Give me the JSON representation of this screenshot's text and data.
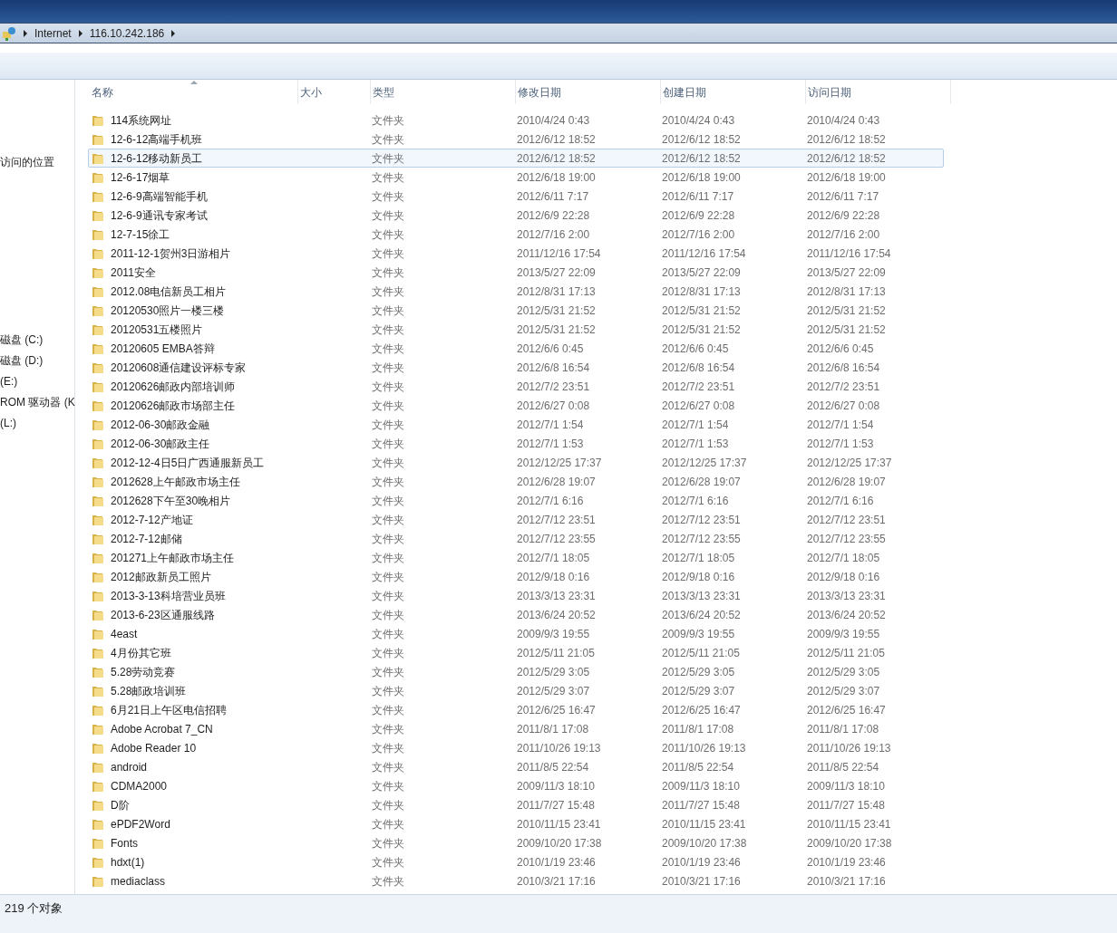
{
  "address_bar": {
    "segments": [
      "Internet",
      "116.10.242.186"
    ]
  },
  "sidebar": {
    "items": [
      {
        "label": "访问的位置",
        "kind": "link"
      },
      {
        "label": "磁盘 (C:)",
        "kind": "drive"
      },
      {
        "label": "磁盘 (D:)",
        "kind": "drive"
      },
      {
        "label": "(E:)",
        "kind": "drive"
      },
      {
        "label": "ROM 驱动器 (K",
        "kind": "drive"
      },
      {
        "label": "(L:)",
        "kind": "drive"
      }
    ]
  },
  "table": {
    "columns": [
      {
        "label": "名称",
        "sorted": true
      },
      {
        "label": "大小",
        "sorted": false
      },
      {
        "label": "类型",
        "sorted": false
      },
      {
        "label": "修改日期",
        "sorted": false
      },
      {
        "label": "创建日期",
        "sorted": false
      },
      {
        "label": "访问日期",
        "sorted": false
      }
    ],
    "rows": [
      {
        "name": "114系统网址",
        "type": "文件夹",
        "modified": "2010/4/24 0:43",
        "created": "2010/4/24 0:43",
        "accessed": "2010/4/24 0:43",
        "selected": false
      },
      {
        "name": "12-6-12高端手机班",
        "type": "文件夹",
        "modified": "2012/6/12 18:52",
        "created": "2012/6/12 18:52",
        "accessed": "2012/6/12 18:52",
        "selected": false
      },
      {
        "name": "12-6-12移动新员工",
        "type": "文件夹",
        "modified": "2012/6/12 18:52",
        "created": "2012/6/12 18:52",
        "accessed": "2012/6/12 18:52",
        "selected": true
      },
      {
        "name": "12-6-17烟草",
        "type": "文件夹",
        "modified": "2012/6/18 19:00",
        "created": "2012/6/18 19:00",
        "accessed": "2012/6/18 19:00",
        "selected": false
      },
      {
        "name": "12-6-9高端智能手机",
        "type": "文件夹",
        "modified": "2012/6/11 7:17",
        "created": "2012/6/11 7:17",
        "accessed": "2012/6/11 7:17",
        "selected": false
      },
      {
        "name": "12-6-9通讯专家考试",
        "type": "文件夹",
        "modified": "2012/6/9 22:28",
        "created": "2012/6/9 22:28",
        "accessed": "2012/6/9 22:28",
        "selected": false
      },
      {
        "name": "12-7-15徐工",
        "type": "文件夹",
        "modified": "2012/7/16 2:00",
        "created": "2012/7/16 2:00",
        "accessed": "2012/7/16 2:00",
        "selected": false
      },
      {
        "name": "2011-12-1贺州3日游相片",
        "type": "文件夹",
        "modified": "2011/12/16 17:54",
        "created": "2011/12/16 17:54",
        "accessed": "2011/12/16 17:54",
        "selected": false
      },
      {
        "name": "2011安全",
        "type": "文件夹",
        "modified": "2013/5/27 22:09",
        "created": "2013/5/27 22:09",
        "accessed": "2013/5/27 22:09",
        "selected": false
      },
      {
        "name": "2012.08电信新员工相片",
        "type": "文件夹",
        "modified": "2012/8/31 17:13",
        "created": "2012/8/31 17:13",
        "accessed": "2012/8/31 17:13",
        "selected": false
      },
      {
        "name": "20120530照片一楼三楼",
        "type": "文件夹",
        "modified": "2012/5/31 21:52",
        "created": "2012/5/31 21:52",
        "accessed": "2012/5/31 21:52",
        "selected": false
      },
      {
        "name": "20120531五楼照片",
        "type": "文件夹",
        "modified": "2012/5/31 21:52",
        "created": "2012/5/31 21:52",
        "accessed": "2012/5/31 21:52",
        "selected": false
      },
      {
        "name": "20120605 EMBA答辩",
        "type": "文件夹",
        "modified": "2012/6/6 0:45",
        "created": "2012/6/6 0:45",
        "accessed": "2012/6/6 0:45",
        "selected": false
      },
      {
        "name": "20120608通信建设评标专家",
        "type": "文件夹",
        "modified": "2012/6/8 16:54",
        "created": "2012/6/8 16:54",
        "accessed": "2012/6/8 16:54",
        "selected": false
      },
      {
        "name": "20120626邮政内部培训师",
        "type": "文件夹",
        "modified": "2012/7/2 23:51",
        "created": "2012/7/2 23:51",
        "accessed": "2012/7/2 23:51",
        "selected": false
      },
      {
        "name": "20120626邮政市场部主任",
        "type": "文件夹",
        "modified": "2012/6/27 0:08",
        "created": "2012/6/27 0:08",
        "accessed": "2012/6/27 0:08",
        "selected": false
      },
      {
        "name": "2012-06-30邮政金融",
        "type": "文件夹",
        "modified": "2012/7/1 1:54",
        "created": "2012/7/1 1:54",
        "accessed": "2012/7/1 1:54",
        "selected": false
      },
      {
        "name": "2012-06-30邮政主任",
        "type": "文件夹",
        "modified": "2012/7/1 1:53",
        "created": "2012/7/1 1:53",
        "accessed": "2012/7/1 1:53",
        "selected": false
      },
      {
        "name": "2012-12-4日5日广西通服新员工",
        "type": "文件夹",
        "modified": "2012/12/25 17:37",
        "created": "2012/12/25 17:37",
        "accessed": "2012/12/25 17:37",
        "selected": false
      },
      {
        "name": "2012628上午邮政市场主任",
        "type": "文件夹",
        "modified": "2012/6/28 19:07",
        "created": "2012/6/28 19:07",
        "accessed": "2012/6/28 19:07",
        "selected": false
      },
      {
        "name": "2012628下午至30晚相片",
        "type": "文件夹",
        "modified": "2012/7/1 6:16",
        "created": "2012/7/1 6:16",
        "accessed": "2012/7/1 6:16",
        "selected": false
      },
      {
        "name": "2012-7-12产地证",
        "type": "文件夹",
        "modified": "2012/7/12 23:51",
        "created": "2012/7/12 23:51",
        "accessed": "2012/7/12 23:51",
        "selected": false
      },
      {
        "name": "2012-7-12邮储",
        "type": "文件夹",
        "modified": "2012/7/12 23:55",
        "created": "2012/7/12 23:55",
        "accessed": "2012/7/12 23:55",
        "selected": false
      },
      {
        "name": "201271上午邮政市场主任",
        "type": "文件夹",
        "modified": "2012/7/1 18:05",
        "created": "2012/7/1 18:05",
        "accessed": "2012/7/1 18:05",
        "selected": false
      },
      {
        "name": "2012邮政新员工照片",
        "type": "文件夹",
        "modified": "2012/9/18 0:16",
        "created": "2012/9/18 0:16",
        "accessed": "2012/9/18 0:16",
        "selected": false
      },
      {
        "name": "2013-3-13科培营业员班",
        "type": "文件夹",
        "modified": "2013/3/13 23:31",
        "created": "2013/3/13 23:31",
        "accessed": "2013/3/13 23:31",
        "selected": false
      },
      {
        "name": "2013-6-23区通服线路",
        "type": "文件夹",
        "modified": "2013/6/24 20:52",
        "created": "2013/6/24 20:52",
        "accessed": "2013/6/24 20:52",
        "selected": false
      },
      {
        "name": "4east",
        "type": "文件夹",
        "modified": "2009/9/3 19:55",
        "created": "2009/9/3 19:55",
        "accessed": "2009/9/3 19:55",
        "selected": false
      },
      {
        "name": "4月份其它班",
        "type": "文件夹",
        "modified": "2012/5/11 21:05",
        "created": "2012/5/11 21:05",
        "accessed": "2012/5/11 21:05",
        "selected": false
      },
      {
        "name": "5.28劳动竞赛",
        "type": "文件夹",
        "modified": "2012/5/29 3:05",
        "created": "2012/5/29 3:05",
        "accessed": "2012/5/29 3:05",
        "selected": false
      },
      {
        "name": "5.28邮政培训班",
        "type": "文件夹",
        "modified": "2012/5/29 3:07",
        "created": "2012/5/29 3:07",
        "accessed": "2012/5/29 3:07",
        "selected": false
      },
      {
        "name": "6月21日上午区电信招聘",
        "type": "文件夹",
        "modified": "2012/6/25 16:47",
        "created": "2012/6/25 16:47",
        "accessed": "2012/6/25 16:47",
        "selected": false
      },
      {
        "name": "Adobe Acrobat 7_CN",
        "type": "文件夹",
        "modified": "2011/8/1 17:08",
        "created": "2011/8/1 17:08",
        "accessed": "2011/8/1 17:08",
        "selected": false
      },
      {
        "name": "Adobe Reader 10",
        "type": "文件夹",
        "modified": "2011/10/26 19:13",
        "created": "2011/10/26 19:13",
        "accessed": "2011/10/26 19:13",
        "selected": false
      },
      {
        "name": "android",
        "type": "文件夹",
        "modified": "2011/8/5 22:54",
        "created": "2011/8/5 22:54",
        "accessed": "2011/8/5 22:54",
        "selected": false
      },
      {
        "name": "CDMA2000",
        "type": "文件夹",
        "modified": "2009/11/3 18:10",
        "created": "2009/11/3 18:10",
        "accessed": "2009/11/3 18:10",
        "selected": false
      },
      {
        "name": "D阶",
        "type": "文件夹",
        "modified": "2011/7/27 15:48",
        "created": "2011/7/27 15:48",
        "accessed": "2011/7/27 15:48",
        "selected": false
      },
      {
        "name": "ePDF2Word",
        "type": "文件夹",
        "modified": "2010/11/15 23:41",
        "created": "2010/11/15 23:41",
        "accessed": "2010/11/15 23:41",
        "selected": false
      },
      {
        "name": "Fonts",
        "type": "文件夹",
        "modified": "2009/10/20 17:38",
        "created": "2009/10/20 17:38",
        "accessed": "2009/10/20 17:38",
        "selected": false
      },
      {
        "name": "hdxt(1)",
        "type": "文件夹",
        "modified": "2010/1/19 23:46",
        "created": "2010/1/19 23:46",
        "accessed": "2010/1/19 23:46",
        "selected": false
      },
      {
        "name": "mediaclass",
        "type": "文件夹",
        "modified": "2010/3/21 17:16",
        "created": "2010/3/21 17:16",
        "accessed": "2010/3/21 17:16",
        "selected": false
      }
    ]
  },
  "status_bar": {
    "text": "219 个对象"
  }
}
